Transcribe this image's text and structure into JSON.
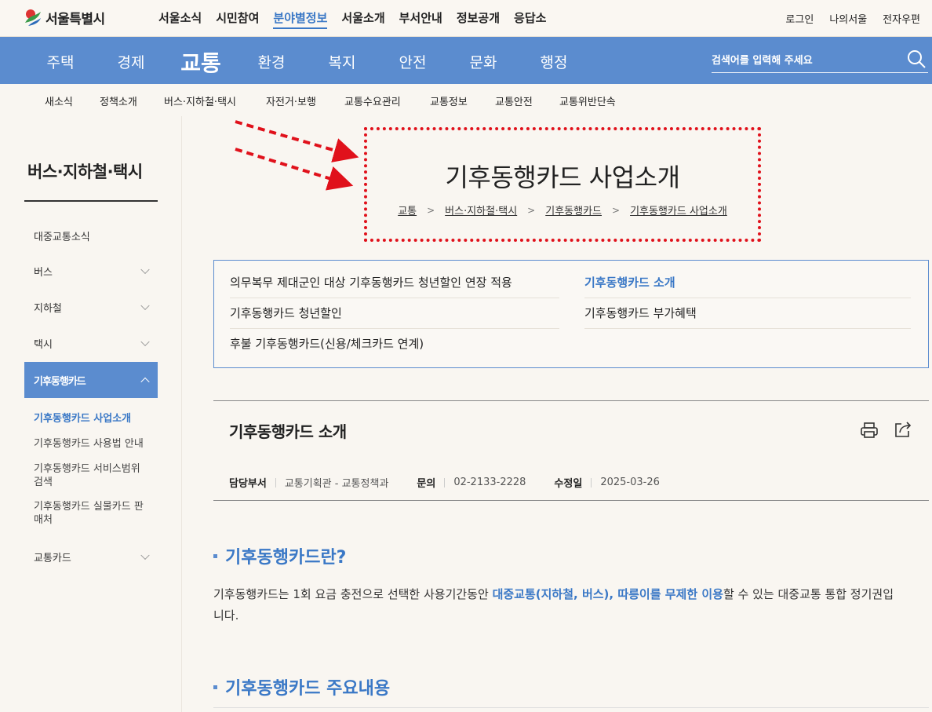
{
  "header": {
    "logo_text": "서울특별시",
    "gnb": [
      "서울소식",
      "시민참여",
      "분야별정보",
      "서울소개",
      "부서안내",
      "정보공개",
      "응답소"
    ],
    "gnb_active_index": 2,
    "util": [
      "로그인",
      "나의서울",
      "전자우편"
    ]
  },
  "main_nav": {
    "items": [
      "주택",
      "경제",
      "교통",
      "환경",
      "복지",
      "안전",
      "문화",
      "행정"
    ],
    "active_index": 2,
    "search_placeholder": "검색어를 입력해 주세요"
  },
  "sub_nav": [
    "새소식",
    "정책소개",
    "버스·지하철·택시",
    "자전거·보행",
    "교통수요관리",
    "교통정보",
    "교통안전",
    "교통위반단속"
  ],
  "sidebar": {
    "title": "버스·지하철·택시",
    "items": [
      "대중교통소식",
      "버스",
      "지하철",
      "택시",
      "기후동행카드",
      "교통카드"
    ],
    "sub_items": [
      "기후동행카드 사업소개",
      "기후동행카드 사용법 안내",
      "기후동행카드 서비스범위 검색",
      "기후동행카드 실물카드 판매처"
    ]
  },
  "page": {
    "title": "기후동행카드 사업소개",
    "breadcrumb": [
      "교통",
      "버스·지하철·택시",
      "기후동행카드",
      "기후동행카드 사업소개"
    ]
  },
  "links": [
    "의무복무 제대군인 대상 기후동행카드 청년할인 연장 적용",
    "기후동행카드 소개",
    "기후동행카드 청년할인",
    "기후동행카드 부가혜택",
    "후불 기후동행카드(신용/체크카드 연계)"
  ],
  "article": {
    "title": "기후동행카드 소개",
    "meta": {
      "dept_label": "담당부서",
      "dept": "교통기획관 - 교통정책과",
      "contact_label": "문의",
      "contact": "02-2133-2228",
      "modified_label": "수정일",
      "modified": "2025-03-26"
    },
    "sections": [
      {
        "heading": "기후동행카드란?",
        "text_1": "기후동행카드는 1회 요금 충전으로 선택한 사용기간동안 ",
        "highlight": "대중교통(지하철, 버스), 따릉이를 무제한 이용",
        "text_2": "할 수 있는 대중교통 통합 정기권입니다."
      },
      {
        "heading": "기후동행카드 주요내용"
      }
    ]
  },
  "colors": {
    "brand_blue": "#5b8ccf",
    "link_blue": "#3a78c6",
    "annotation_red": "#e0111b"
  }
}
